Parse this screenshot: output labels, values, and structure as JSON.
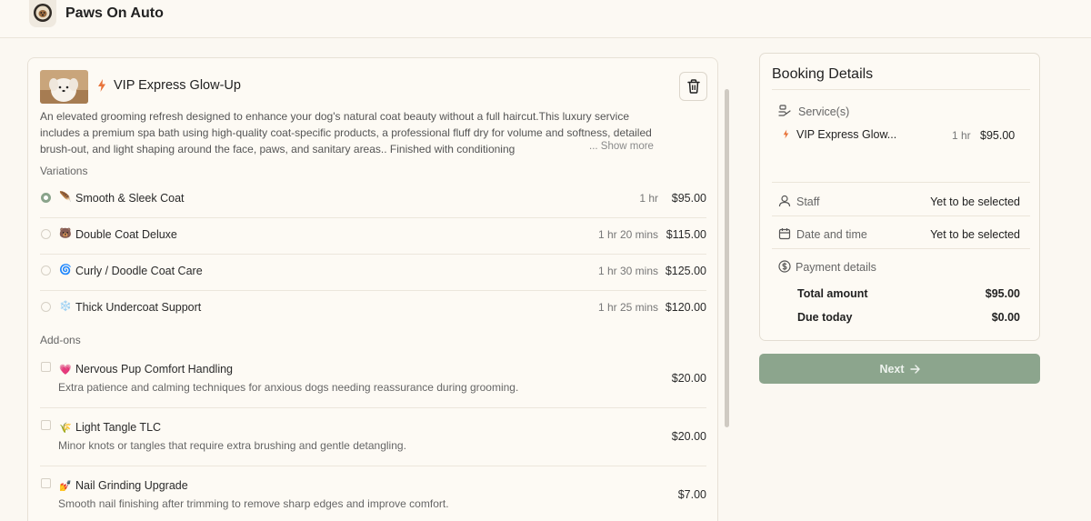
{
  "app": {
    "brand": "Paws On Auto"
  },
  "colors": {
    "accent": "#8ca58d",
    "bolt": "#e8743b",
    "background": "#fbf8f2"
  },
  "service": {
    "title": "VIP Express Glow-Up",
    "description": "An elevated grooming refresh designed to enhance your dog's natural coat beauty without a full haircut.This luxury service includes a premium spa bath using high-quality coat-specific products, a professional fluff dry for volume and softness, detailed brush-out, and light shaping around the face, paws, and sanitary areas.. Finished with conditioning",
    "show_more": "... Show more",
    "delete_icon": "trash-icon"
  },
  "variations": {
    "label": "Variations",
    "items": [
      {
        "emoji": "🪶",
        "label": "Smooth & Sleek Coat",
        "duration": "1 hr",
        "price": "$95.00",
        "selected": true
      },
      {
        "emoji": "🐻",
        "label": "Double Coat Deluxe",
        "duration": "1 hr 20 mins",
        "price": "$115.00",
        "selected": false
      },
      {
        "emoji": "🌀",
        "label": "Curly / Doodle Coat Care",
        "duration": "1 hr 30 mins",
        "price": "$125.00",
        "selected": false
      },
      {
        "emoji": "❄️",
        "label": "Thick Undercoat Support",
        "duration": "1 hr 25 mins",
        "price": "$120.00",
        "selected": false
      }
    ]
  },
  "addons": {
    "label": "Add-ons",
    "items": [
      {
        "emoji": "💗",
        "label": "Nervous Pup Comfort Handling",
        "desc": "Extra patience and calming techniques for anxious dogs needing reassurance during grooming.",
        "price": "$20.00"
      },
      {
        "emoji": "🌾",
        "label": "Light Tangle TLC",
        "desc": "Minor knots or tangles that require extra brushing and gentle detangling.",
        "price": "$20.00"
      },
      {
        "emoji": "💅",
        "label": "Nail Grinding Upgrade",
        "desc": "Smooth nail finishing after trimming to remove sharp edges and improve comfort.",
        "price": "$7.00"
      }
    ]
  },
  "booking": {
    "title": "Booking Details",
    "services_label": "Service(s)",
    "service_name": "VIP Express Glow...",
    "service_duration": "1 hr",
    "service_price": "$95.00",
    "staff_label": "Staff",
    "staff_value": "Yet to be selected",
    "datetime_label": "Date and time",
    "datetime_value": "Yet to be selected",
    "payment_label": "Payment details",
    "total_label": "Total amount",
    "total_value": "$95.00",
    "due_label": "Due today",
    "due_value": "$0.00"
  },
  "actions": {
    "next_label": "Next"
  }
}
